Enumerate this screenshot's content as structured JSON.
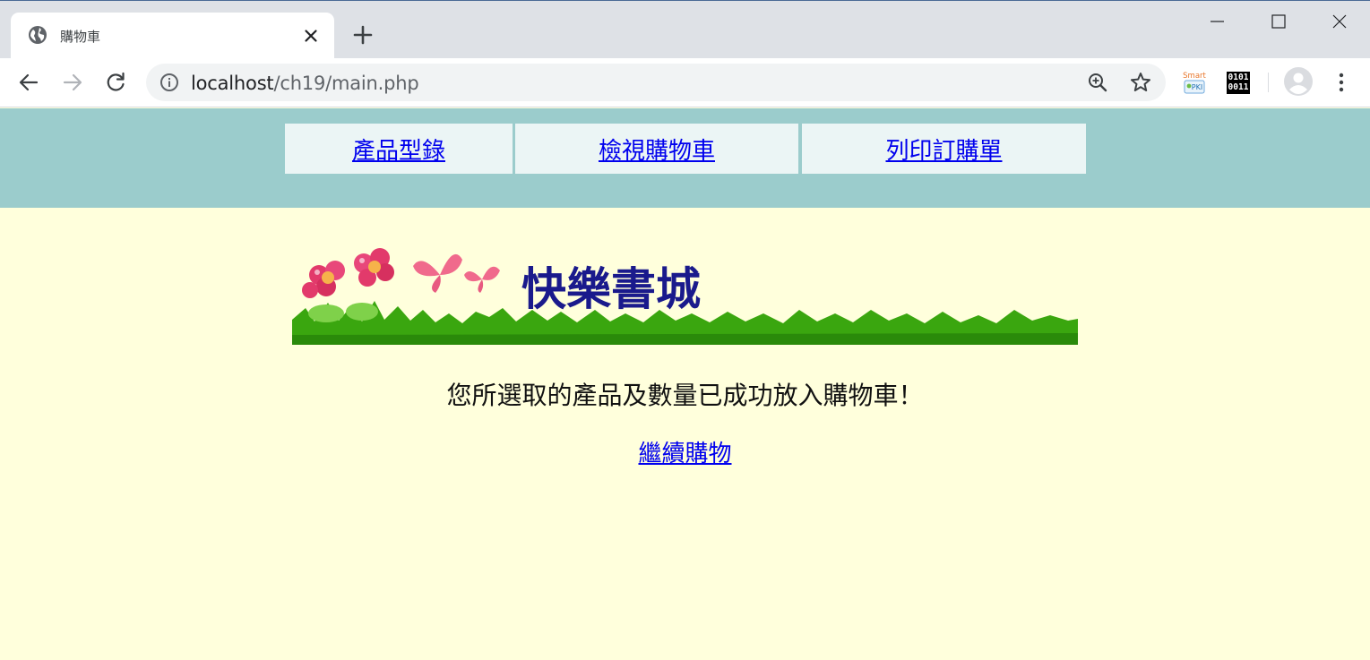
{
  "browser": {
    "tab_title": "購物車",
    "url_host": "localhost",
    "url_path": "/ch19/main.php",
    "extensions": {
      "smart_pki_label_top": "Smart",
      "smart_pki_label_bottom": "PKI",
      "binary_line1": "0101",
      "binary_line2": "0011"
    }
  },
  "nav_menu": {
    "items": [
      {
        "label": "產品型錄"
      },
      {
        "label": "檢視購物車"
      },
      {
        "label": "列印訂購單"
      }
    ]
  },
  "banner": {
    "title": "快樂書城"
  },
  "main": {
    "message": "您所選取的產品及數量已成功放入購物車！",
    "continue_link": "繼續購物"
  },
  "colors": {
    "menu_band": "#9bcccc",
    "menu_cell": "#ebf5f5",
    "page_background": "#ffffdc",
    "link": "#0000ee"
  }
}
